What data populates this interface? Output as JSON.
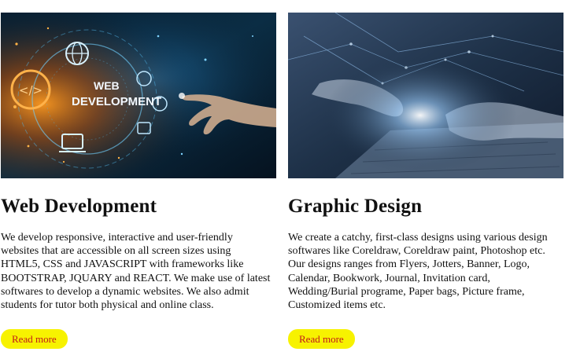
{
  "cards": [
    {
      "image_text_line1": "WEB",
      "image_text_line2": "DEVELOPMENT",
      "title": "Web Development",
      "text": "We develop responsive, interactive and user-friendly websites that are accessible on all screen sizes using HTML5, CSS and JAVASCRIPT with frameworks like BOOTSTRAP, JQUARY and REACT. We make use of latest softwares to develop a dynamic websites. We also admit students for tutor both physical and online class.",
      "button_label": "Read more"
    },
    {
      "title": "Graphic Design",
      "text": "We create a catchy, first-class designs using various design softwares like Coreldraw, Coreldraw paint, Photoshop etc. Our designs ranges from Flyers, Jotters, Banner, Logo, Calendar, Bookwork, Journal, Invitation card, Wedding/Burial programe, Paper bags, Picture frame, Customized items etc.",
      "button_label": "Read more"
    }
  ],
  "colors": {
    "button_bg": "#f7f200",
    "button_text": "#c11a1a",
    "web_dev_bg": "#061a2b",
    "graphic_bg": "#1b2a40"
  }
}
